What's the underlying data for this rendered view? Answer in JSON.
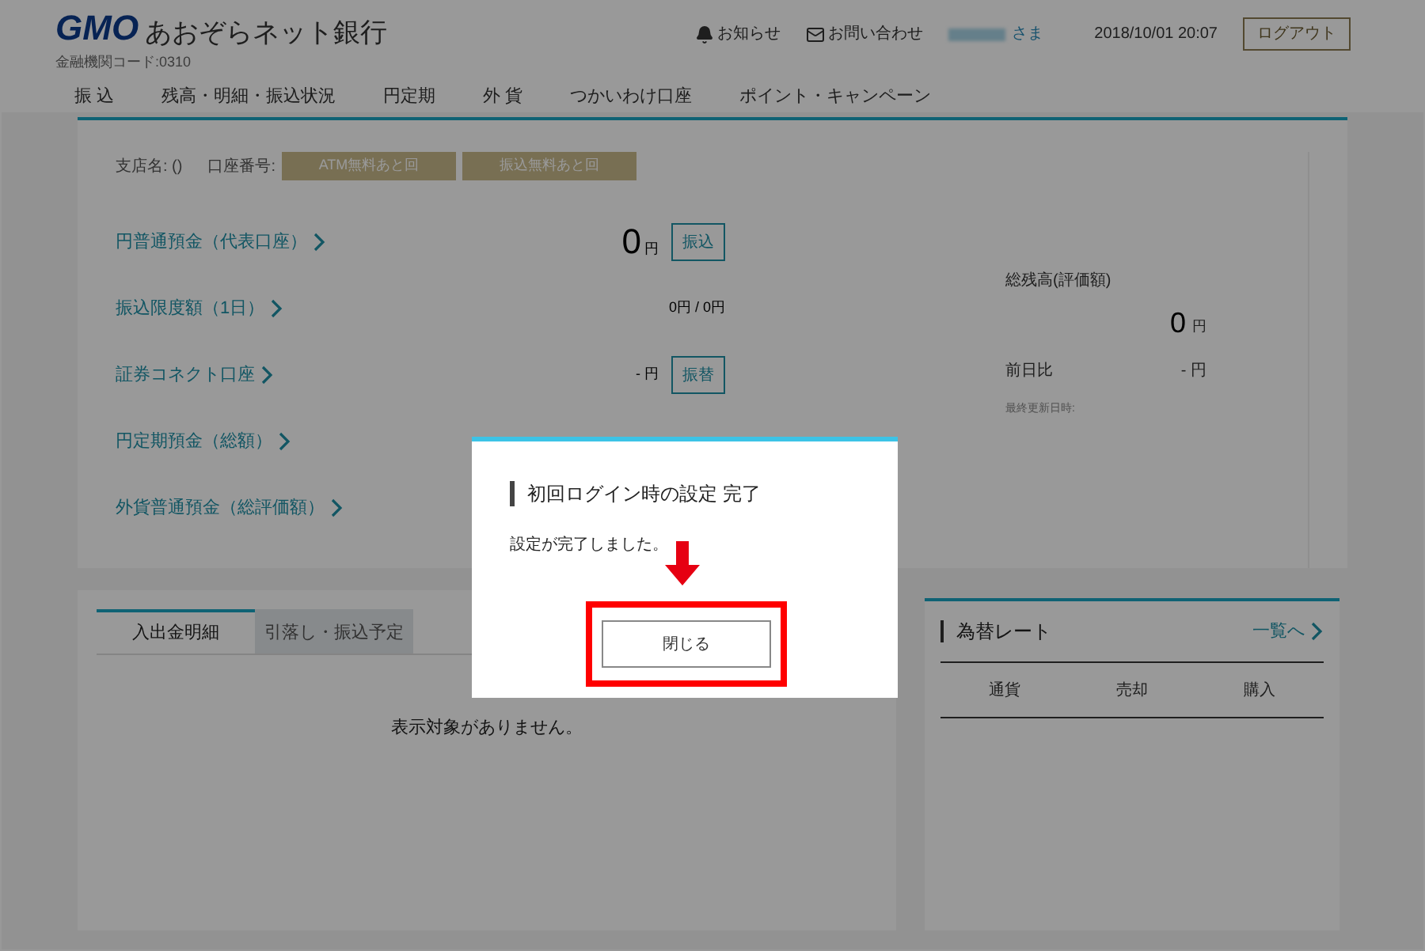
{
  "header": {
    "logo": "GMO",
    "bank_name": "あおぞらネット銀行",
    "bank_code": "金融機関コード:0310",
    "links": [
      {
        "kind": "bell",
        "label": "お知らせ"
      },
      {
        "kind": "mail",
        "label": "お問い合わせ"
      }
    ],
    "user_suffix": "さま",
    "datetime": "2018/10/01 20:07",
    "logout": "ログアウト"
  },
  "nav": [
    "振 込",
    "残高・明細・振込状況",
    "円定期",
    "外 貨",
    "つかいわけ口座",
    "ポイント・キャンペーン"
  ],
  "account": {
    "branch": "支店名: ()",
    "number_label": "口座番号:",
    "badges": [
      "ATM無料あと回",
      "振込無料あと回"
    ],
    "rows": [
      {
        "kind": "big",
        "label": "円普通預金（代表口座）",
        "amount": "0",
        "unit": "円",
        "button": "振込"
      },
      {
        "kind": "plain",
        "label": "振込限度額（1日）",
        "amount": "0円 / 0円"
      },
      {
        "kind": "plain",
        "label": "証券コネクト口座",
        "amount": "- 円",
        "button": "振替"
      },
      {
        "kind": "label",
        "label": "円定期預金（総額）"
      },
      {
        "kind": "label",
        "label": "外貨普通預金（総評価額）"
      }
    ],
    "summary": {
      "title": "総残高(評価額)",
      "amount": "0",
      "unit": "円",
      "diff_label": "前日比",
      "diff_value": "- 円",
      "updated": "最終更新日時:"
    }
  },
  "history": {
    "tabs": [
      {
        "label": "入出金明細",
        "selected": true
      },
      {
        "label": "引落し・振込予定",
        "selected": false
      }
    ],
    "empty": "表示対象がありません。"
  },
  "rates": {
    "title": "為替レート",
    "link": "一覧へ",
    "columns": [
      "通貨",
      "売却",
      "購入"
    ]
  },
  "modal": {
    "title": "初回ログイン時の設定 完了",
    "message": "設定が完了しました。",
    "button": "閉じる"
  }
}
